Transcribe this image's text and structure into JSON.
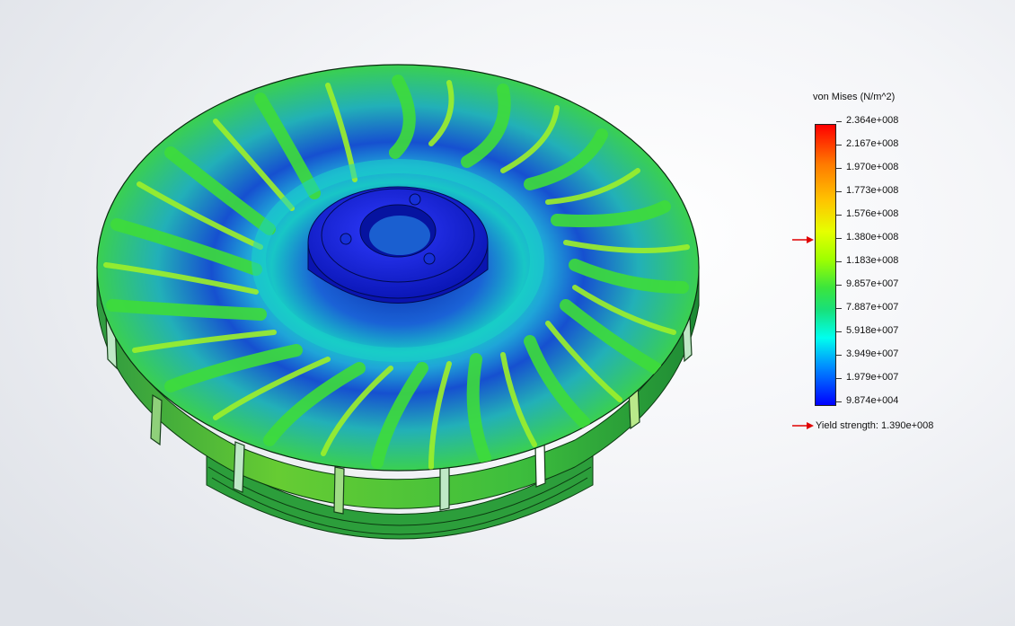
{
  "legend": {
    "title": "von Mises (N/m^2)",
    "ticks": [
      "2.364e+008",
      "2.167e+008",
      "1.970e+008",
      "1.773e+008",
      "1.576e+008",
      "1.380e+008",
      "1.183e+008",
      "9.857e+007",
      "7.887e+007",
      "5.918e+007",
      "3.949e+007",
      "1.979e+007",
      "9.874e+004"
    ],
    "yield_label": "Yield strength: 1.390e+008"
  },
  "colors": {
    "max": "#ff0000",
    "mid": "#3ce53c",
    "min": "#0000ff",
    "marker": "#e00000"
  },
  "icons": {
    "yield_marker": "red-arrow-icon"
  }
}
